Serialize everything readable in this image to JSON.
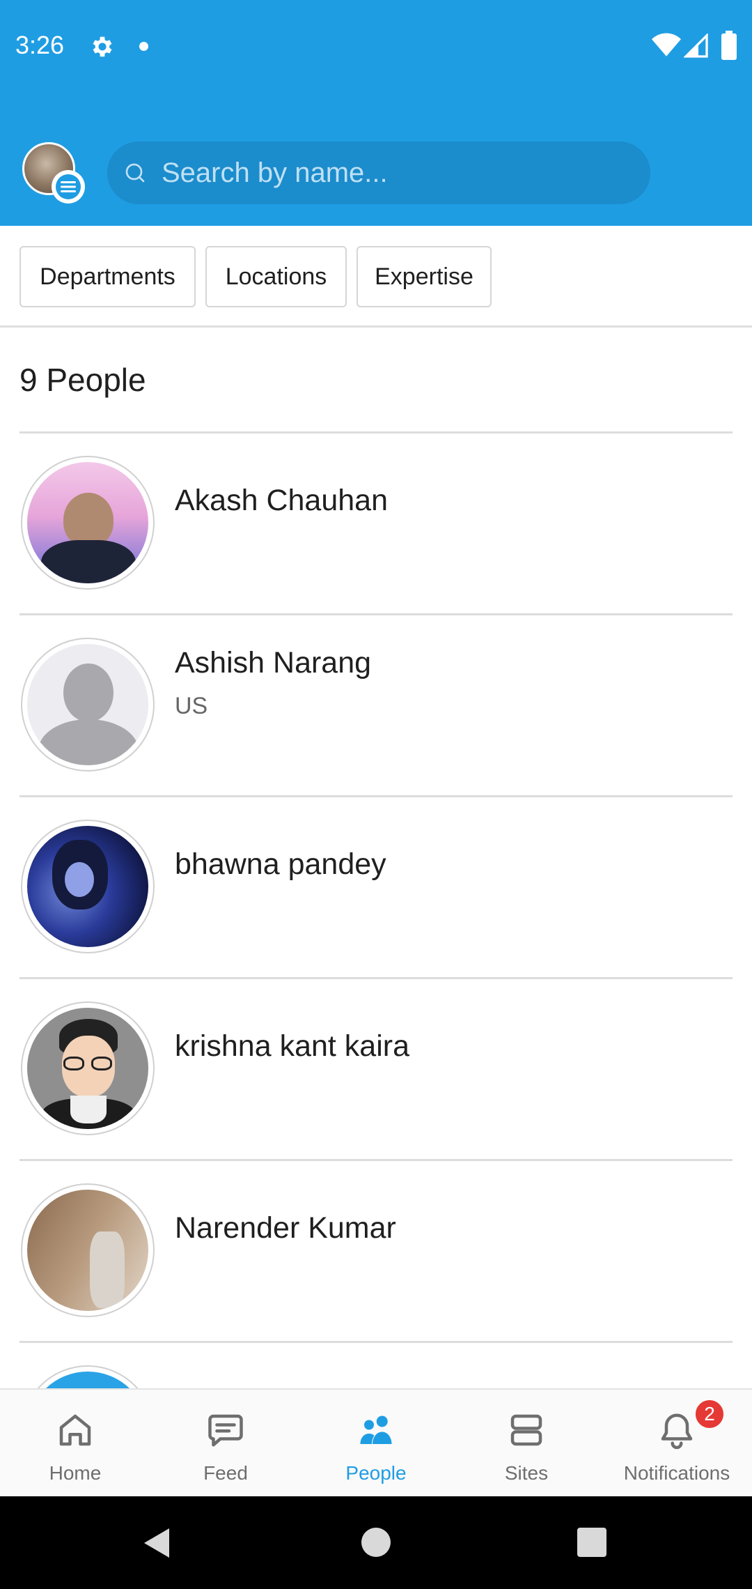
{
  "status_bar": {
    "time": "3:26",
    "icons": [
      "gear-icon",
      "dot-icon",
      "wifi-icon",
      "signal-icon",
      "battery-icon"
    ]
  },
  "app_bar": {
    "search": {
      "placeholder": "Search by name...",
      "value": ""
    }
  },
  "filters": [
    "Departments",
    "Locations",
    "Expertise"
  ],
  "people_count": "9 People",
  "people": [
    {
      "name": "Akash Chauhan",
      "subtitle": ""
    },
    {
      "name": "Ashish Narang",
      "subtitle": "US"
    },
    {
      "name": "bhawna pandey",
      "subtitle": ""
    },
    {
      "name": "krishna kant kaira",
      "subtitle": ""
    },
    {
      "name": "Narender Kumar",
      "subtitle": ""
    }
  ],
  "bottom_nav": [
    {
      "label": "Home",
      "icon": "home-icon",
      "active": false
    },
    {
      "label": "Feed",
      "icon": "feed-icon",
      "active": false
    },
    {
      "label": "People",
      "icon": "people-icon",
      "active": true
    },
    {
      "label": "Sites",
      "icon": "sites-icon",
      "active": false
    },
    {
      "label": "Notifications",
      "icon": "bell-icon",
      "active": false,
      "badge": "2"
    }
  ],
  "colors": {
    "brand": "#1f9de3",
    "badge": "#e53935"
  }
}
